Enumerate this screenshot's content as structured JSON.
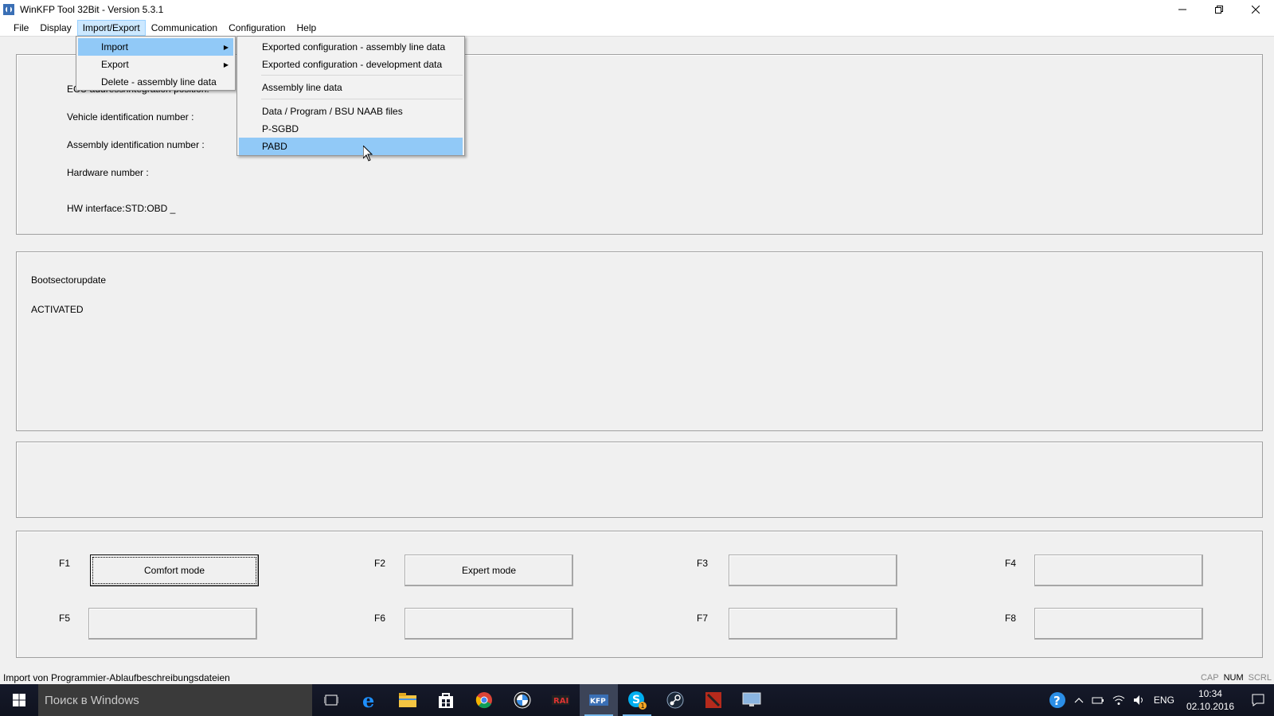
{
  "window": {
    "title": "WinKFP Tool 32Bit - Version 5.3.1"
  },
  "menubar": {
    "items": [
      "File",
      "Display",
      "Import/Export",
      "Communication",
      "Configuration",
      "Help"
    ],
    "active": "Import/Export"
  },
  "import_export_menu": {
    "items": [
      {
        "label": "Import",
        "submenu": true
      },
      {
        "label": "Export",
        "submenu": true
      },
      {
        "label": "Delete - assembly line data",
        "submenu": false
      }
    ]
  },
  "import_submenu": {
    "items": [
      "Exported configuration - assembly line data",
      "Exported configuration - development data",
      "Assembly line data",
      "Data / Program / BSU NAAB files",
      "P-SGBD",
      "PABD"
    ],
    "highlighted": "PABD"
  },
  "info_panel": {
    "ecu_label": "ECU address/integration position:",
    "vin_label": "Vehicle identification number :",
    "assembly_label": "Assembly identification number :",
    "hardware_label": "Hardware number :",
    "hw_interface_label": "HW interface:",
    "hw_interface_value": "STD:OBD _"
  },
  "status_panel": {
    "line1": "Bootsectorupdate",
    "line2": "ACTIVATED"
  },
  "function_keys": [
    {
      "key": "F1",
      "label": "Comfort mode"
    },
    {
      "key": "F2",
      "label": "Expert mode"
    },
    {
      "key": "F3",
      "label": ""
    },
    {
      "key": "F4",
      "label": ""
    },
    {
      "key": "F5",
      "label": ""
    },
    {
      "key": "F6",
      "label": ""
    },
    {
      "key": "F7",
      "label": ""
    },
    {
      "key": "F8",
      "label": ""
    }
  ],
  "statusbar": {
    "text": "Import von Programmier-Ablaufbeschreibungsdateien",
    "indicators": [
      "CAP",
      "NUM",
      "SCRL"
    ]
  },
  "taskbar": {
    "search_placeholder": "Поиск в Windows",
    "language": "ENG",
    "time": "10:34",
    "date": "02.10.2016",
    "skype_badge": "1"
  },
  "colors": {
    "menu_highlight": "#91c9f7",
    "menubar_active": "#cce8ff",
    "taskbar_bg": "#15192a"
  }
}
